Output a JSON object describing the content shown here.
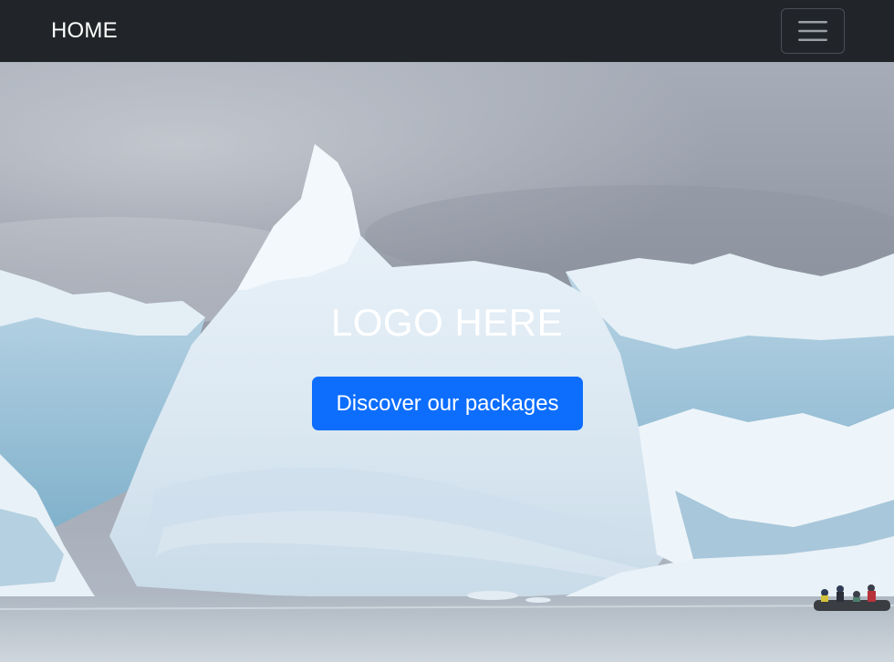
{
  "navbar": {
    "brand": "HOME",
    "toggler_icon": "hamburger-menu-icon"
  },
  "hero": {
    "logo_text": "LOGO HERE",
    "cta_label": "Discover our packages",
    "background": "icebergs-photo"
  },
  "colors": {
    "navbar_bg": "#212529",
    "primary": "#0d6efd",
    "text_light": "#ffffff"
  }
}
